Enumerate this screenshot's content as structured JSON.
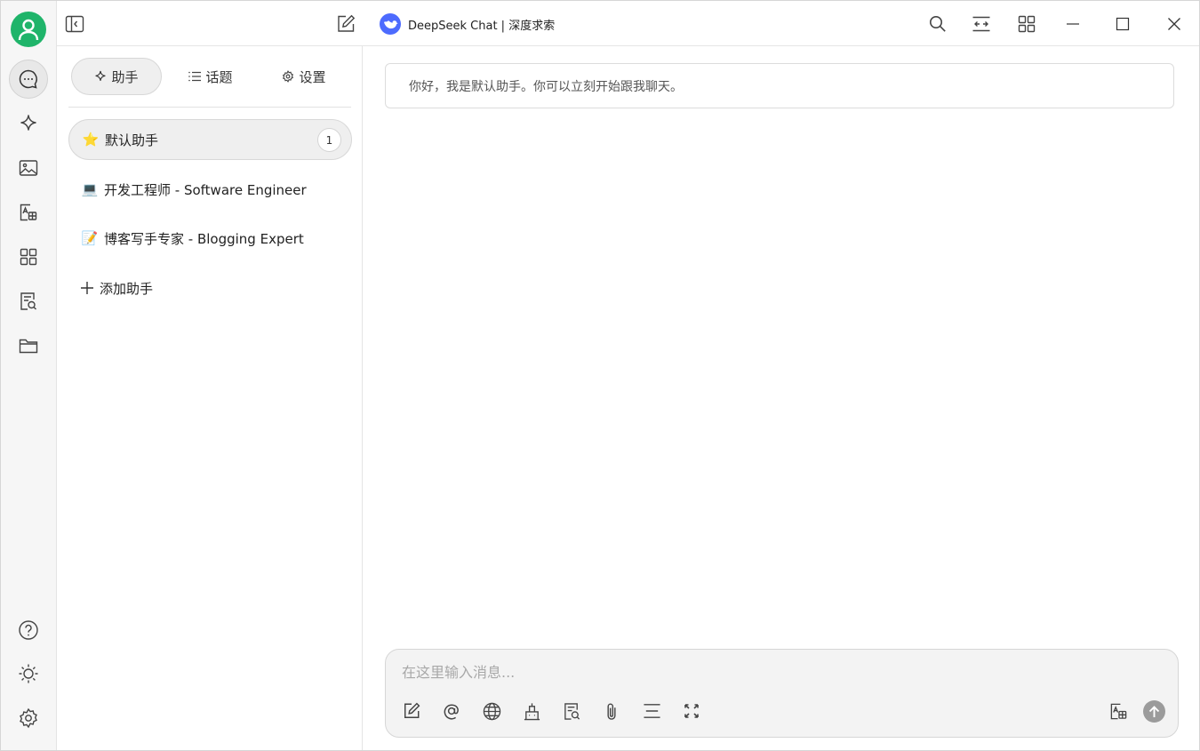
{
  "window": {
    "title": "DeepSeek Chat | 深度求索"
  },
  "rail": {
    "items": [
      {
        "icon": "chat-bubble-icon",
        "active": true
      },
      {
        "icon": "sparkle-icon"
      },
      {
        "icon": "image-icon"
      },
      {
        "icon": "translate-icon"
      },
      {
        "icon": "apps-grid-icon"
      },
      {
        "icon": "document-search-icon"
      },
      {
        "icon": "folder-icon"
      }
    ],
    "bottom": [
      {
        "icon": "help-icon"
      },
      {
        "icon": "sun-icon"
      },
      {
        "icon": "settings-gear-icon"
      }
    ]
  },
  "panel": {
    "tabs": [
      {
        "label": "助手",
        "icon": "sparkle-icon",
        "active": true
      },
      {
        "label": "话题",
        "icon": "list-icon"
      },
      {
        "label": "设置",
        "icon": "gear-icon"
      }
    ],
    "assistants": [
      {
        "emoji": "⭐",
        "name": "默认助手",
        "count": "1",
        "active": true
      },
      {
        "emoji": "💻",
        "name": "开发工程师 - Software Engineer"
      },
      {
        "emoji": "📝",
        "name": "博客写手专家 - Blogging Expert"
      }
    ],
    "add_label": "添加助手"
  },
  "chat": {
    "greeting": "你好，我是默认助手。你可以立刻开始跟我聊天。",
    "input_placeholder": "在这里输入消息..."
  },
  "colors": {
    "avatar": "#1fb46a",
    "deepseek_logo": "#4d6bfe",
    "send_button": "#9b9b9b"
  }
}
